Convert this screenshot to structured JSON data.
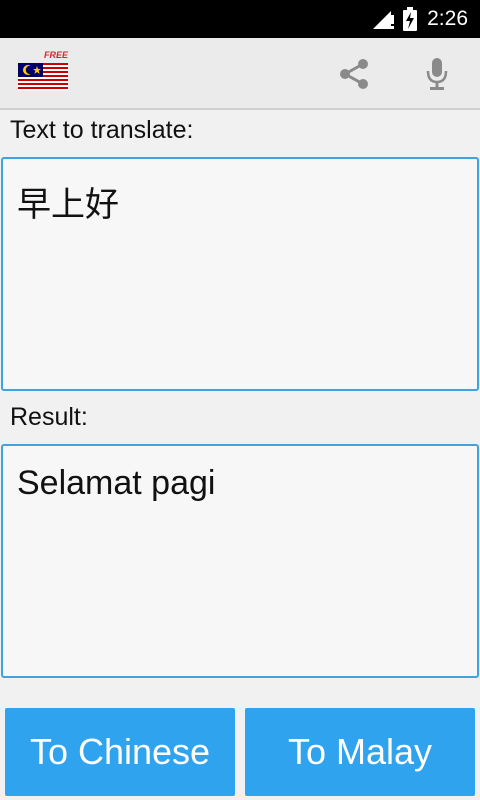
{
  "status_bar": {
    "time": "2:26",
    "icons": [
      "signal-icon",
      "battery-charging-icon"
    ]
  },
  "action_bar": {
    "app_icon": "malaysia-flag-icon",
    "badge": "FREE",
    "actions": [
      "share-icon",
      "microphone-icon"
    ]
  },
  "source": {
    "label": "Text to translate:",
    "text": "早上好"
  },
  "result": {
    "label": "Result:",
    "text": "Selamat pagi"
  },
  "buttons": {
    "to_chinese": "To Chinese",
    "to_malay": "To Malay"
  },
  "colors": {
    "accent": "#2fa3ee",
    "border": "#3fa3df",
    "background": "#f1f1f1"
  }
}
